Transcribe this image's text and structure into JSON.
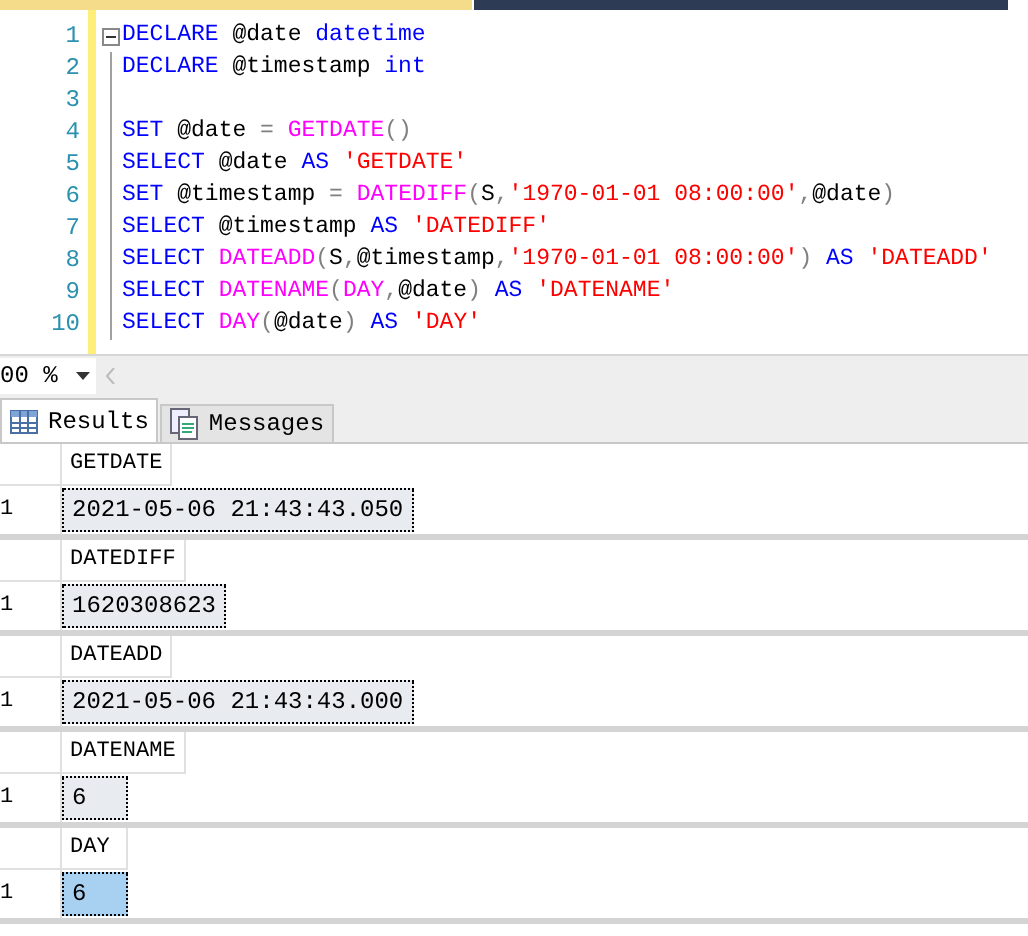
{
  "editor": {
    "lines": [
      {
        "number": "1",
        "fold": true,
        "tokens": [
          {
            "kind": "keyword",
            "text": "DECLARE"
          },
          {
            "kind": "plain",
            "text": " @date "
          },
          {
            "kind": "keyword",
            "text": "datetime"
          }
        ]
      },
      {
        "number": "2",
        "fold": false,
        "tokens": [
          {
            "kind": "keyword",
            "text": "DECLARE"
          },
          {
            "kind": "plain",
            "text": " @timestamp "
          },
          {
            "kind": "keyword",
            "text": "int"
          }
        ]
      },
      {
        "number": "3",
        "fold": false
      },
      {
        "number": "4",
        "fold": false,
        "tokens": [
          {
            "kind": "keyword",
            "text": "SET"
          },
          {
            "kind": "plain",
            "text": " @date "
          },
          {
            "kind": "operator",
            "text": "= "
          },
          {
            "kind": "function",
            "text": "GETDATE"
          },
          {
            "kind": "operator",
            "text": "()"
          }
        ]
      },
      {
        "number": "5",
        "fold": false,
        "tokens": [
          {
            "kind": "keyword",
            "text": "SELECT"
          },
          {
            "kind": "plain",
            "text": " @date "
          },
          {
            "kind": "keyword",
            "text": "AS "
          },
          {
            "kind": "string",
            "text": "'GETDATE'"
          }
        ]
      },
      {
        "number": "6",
        "fold": false,
        "tokens": [
          {
            "kind": "keyword",
            "text": "SET"
          },
          {
            "kind": "plain",
            "text": " @timestamp "
          },
          {
            "kind": "operator",
            "text": "= "
          },
          {
            "kind": "function",
            "text": "DATEDIFF"
          },
          {
            "kind": "operator",
            "text": "("
          },
          {
            "kind": "plain",
            "text": "S"
          },
          {
            "kind": "operator",
            "text": ","
          },
          {
            "kind": "string",
            "text": "'1970-01-01 08:00:00'"
          },
          {
            "kind": "operator",
            "text": ","
          },
          {
            "kind": "plain",
            "text": "@date"
          },
          {
            "kind": "operator",
            "text": ")"
          }
        ]
      },
      {
        "number": "7",
        "fold": false,
        "tokens": [
          {
            "kind": "keyword",
            "text": "SELECT"
          },
          {
            "kind": "plain",
            "text": " @timestamp "
          },
          {
            "kind": "keyword",
            "text": "AS "
          },
          {
            "kind": "string",
            "text": "'DATEDIFF'"
          }
        ]
      },
      {
        "number": "8",
        "fold": false,
        "tokens": [
          {
            "kind": "keyword",
            "text": "SELECT "
          },
          {
            "kind": "function",
            "text": "DATEADD"
          },
          {
            "kind": "operator",
            "text": "("
          },
          {
            "kind": "plain",
            "text": "S"
          },
          {
            "kind": "operator",
            "text": ","
          },
          {
            "kind": "plain",
            "text": "@timestamp"
          },
          {
            "kind": "operator",
            "text": ","
          },
          {
            "kind": "string",
            "text": "'1970-01-01 08:00:00'"
          },
          {
            "kind": "operator",
            "text": ") "
          },
          {
            "kind": "keyword",
            "text": "AS "
          },
          {
            "kind": "string",
            "text": "'DATEADD'"
          }
        ]
      },
      {
        "number": "9",
        "fold": false,
        "tokens": [
          {
            "kind": "keyword",
            "text": "SELECT "
          },
          {
            "kind": "function",
            "text": "DATENAME"
          },
          {
            "kind": "operator",
            "text": "("
          },
          {
            "kind": "function",
            "text": "DAY"
          },
          {
            "kind": "operator",
            "text": ","
          },
          {
            "kind": "plain",
            "text": "@date"
          },
          {
            "kind": "operator",
            "text": ") "
          },
          {
            "kind": "keyword",
            "text": "AS "
          },
          {
            "kind": "string",
            "text": "'DATENAME'"
          }
        ]
      },
      {
        "number": "10",
        "fold": false,
        "tokens": [
          {
            "kind": "keyword",
            "text": "SELECT "
          },
          {
            "kind": "function",
            "text": "DAY"
          },
          {
            "kind": "operator",
            "text": "("
          },
          {
            "kind": "plain",
            "text": "@date"
          },
          {
            "kind": "operator",
            "text": ") "
          },
          {
            "kind": "keyword",
            "text": "AS "
          },
          {
            "kind": "string",
            "text": "'DAY'"
          }
        ]
      }
    ]
  },
  "zoom": {
    "value": "00 %"
  },
  "tabs": [
    {
      "label": "Results",
      "selected": true
    },
    {
      "label": "Messages",
      "selected": false
    }
  ],
  "results": [
    {
      "column": "GETDATE",
      "row_number": "1",
      "value": "2021-05-06 21:43:43.050",
      "selected": false
    },
    {
      "column": "DATEDIFF",
      "row_number": "1",
      "value": "1620308623",
      "selected": false
    },
    {
      "column": "DATEADD",
      "row_number": "1",
      "value": "2021-05-06 21:43:43.000",
      "selected": false
    },
    {
      "column": "DATENAME",
      "row_number": "1",
      "value": "6",
      "selected": false
    },
    {
      "column": "DAY",
      "row_number": "1",
      "value": "6",
      "selected": true
    }
  ]
}
